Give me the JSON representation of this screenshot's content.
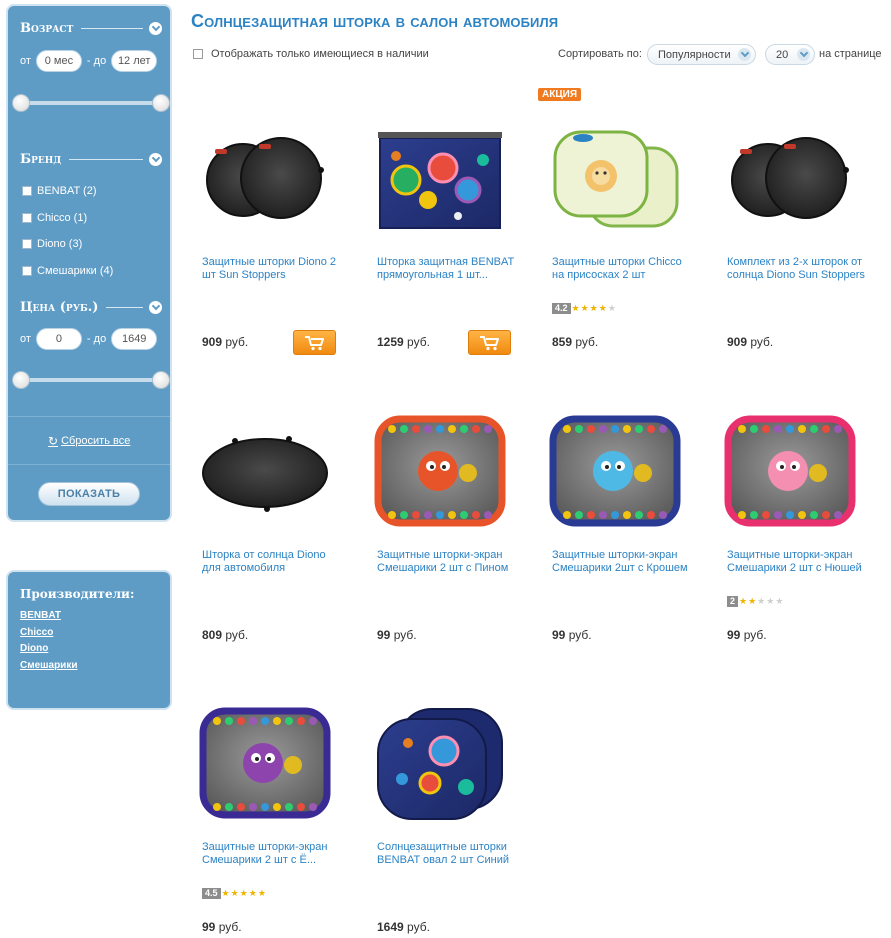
{
  "filters": {
    "age": {
      "title": "Возраст",
      "from_label": "от",
      "to_label": "до",
      "min_value": "0 мес",
      "max_value": "12 лет"
    },
    "brand": {
      "title": "Бренд",
      "items": [
        {
          "label": "BENBAT (2)"
        },
        {
          "label": "Chicco (1)"
        },
        {
          "label": "Diono (3)"
        },
        {
          "label": "Смешарики (4)"
        }
      ]
    },
    "price": {
      "title": "Цена (руб.)",
      "from_label": "от",
      "to_label": "до",
      "min_value": "0",
      "max_value": "1649"
    },
    "reset_label": "Сбросить все",
    "show_label": "ПОКАЗАТЬ"
  },
  "makers": {
    "title": "Производители:",
    "items": [
      "BENBAT",
      "Chicco",
      "Diono",
      "Смешарики"
    ]
  },
  "page": {
    "title": "Солнцезащитная шторка в салон автомобиля"
  },
  "toolbar": {
    "stock_label": "Отображать только имеющиеся в наличии",
    "sort_label": "Сортировать по:",
    "sort_value": "Популярности",
    "per_page_value": "20",
    "per_page_label": "на странице"
  },
  "promo_label": "АКЦИЯ",
  "currency": "руб.",
  "products": [
    {
      "title": "Защитные шторки Diono 2 шт Sun Stoppers",
      "price": "909",
      "image": "dark-round-shades",
      "cart": true,
      "rating": null
    },
    {
      "title": "Шторка защитная BENBAT прямоугольная 1 шт...",
      "price": "1259",
      "image": "space-rect-shade",
      "cart": true,
      "rating": null
    },
    {
      "title": "Защитные шторки Chicco на присосках 2 шт",
      "price": "859",
      "image": "green-lion-shades",
      "cart": false,
      "rating": {
        "score": "4.2",
        "filled": 4
      }
    },
    {
      "title": "Комплект из 2-х шторок от солнца Diono Sun Stoppers",
      "price": "909",
      "image": "dark-round-shades",
      "cart": false,
      "rating": null
    },
    {
      "title": "Шторка от солнца Diono для автомобиля",
      "price": "809",
      "image": "dark-oval-shade",
      "cart": false,
      "rating": null
    },
    {
      "title": "Защитные шторки-экран Смешарики 2 шт с Пином",
      "price": "99",
      "image": "smeshariki-pin",
      "cart": false,
      "rating": null
    },
    {
      "title": "Защитные шторки-экран Смешарики 2шт с Крошем",
      "price": "99",
      "image": "smeshariki-krosh",
      "cart": false,
      "rating": null
    },
    {
      "title": "Защитные шторки-экран Смешарики 2 шт с Нюшей",
      "price": "99",
      "image": "smeshariki-nyusha",
      "cart": false,
      "rating": {
        "score": "2",
        "filled": 2
      }
    },
    {
      "title": "Защитные шторки-экран Смешарики 2 шт с Ё...",
      "price": "99",
      "image": "smeshariki-yozhik",
      "cart": false,
      "rating": {
        "score": "4.5",
        "filled": 4.5
      }
    },
    {
      "title": "Солнцезащитные шторки BENBAT овал 2 шт Синий",
      "price": "1649",
      "image": "space-oval-shades",
      "cart": false,
      "rating": null
    }
  ],
  "colors": {
    "sidebar": "#5e9cc6",
    "link": "#2c83c4",
    "cart": "#f08a10",
    "promo": "#f07a1f",
    "star": "#f0b400"
  }
}
